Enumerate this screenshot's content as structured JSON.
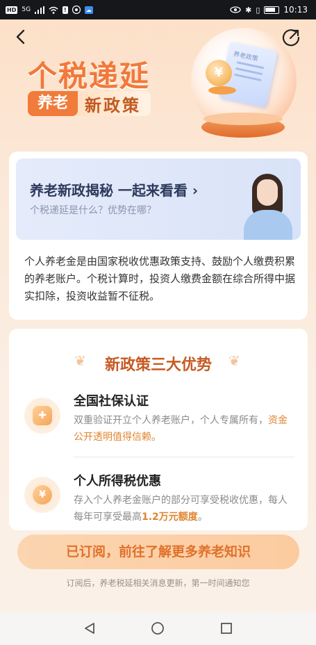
{
  "status_bar": {
    "time": "10:13",
    "left_badges": [
      "HD",
      "5G",
      "!"
    ]
  },
  "header": {
    "hero_title": "个税递延",
    "pill_left": "养老",
    "pill_right": "新政策",
    "illustration_doc_text": "养老政策",
    "coin_symbol": "¥"
  },
  "intro": {
    "banner_title": "养老新政揭秘 一起来看看 ›",
    "banner_subtitle": "个税递延是什么？优势在哪？",
    "body": "个人养老金是由国家税收优惠政策支持、鼓励个人缴费积累的养老账户。个税计算时，投资人缴费金额在综合所得中据实扣除，投资收益暂不征税。"
  },
  "advantages": {
    "title": "新政策三大优势",
    "items": [
      {
        "head": "全国社保认证",
        "desc_plain": "双重验证开立个人养老账户，个人专属所有，",
        "desc_highlight": "资金公开透明值得信赖。",
        "icon": "shield-icon"
      },
      {
        "head": "个人所得税优惠",
        "desc_plain": "存入个人养老金账户的部分可享受税收优惠，每人每年可享受最高",
        "desc_highlight": "1.2万元额度",
        "desc_tail": "。",
        "icon": "coin-icon"
      }
    ]
  },
  "cta": {
    "label": "已订阅，前往了解更多养老知识",
    "note": "订阅后，养老税延相关消息更新，第一时间通知您"
  },
  "colors": {
    "accent": "#f07b3a",
    "cta_text": "#e0712b",
    "highlight": "#e0852f"
  }
}
